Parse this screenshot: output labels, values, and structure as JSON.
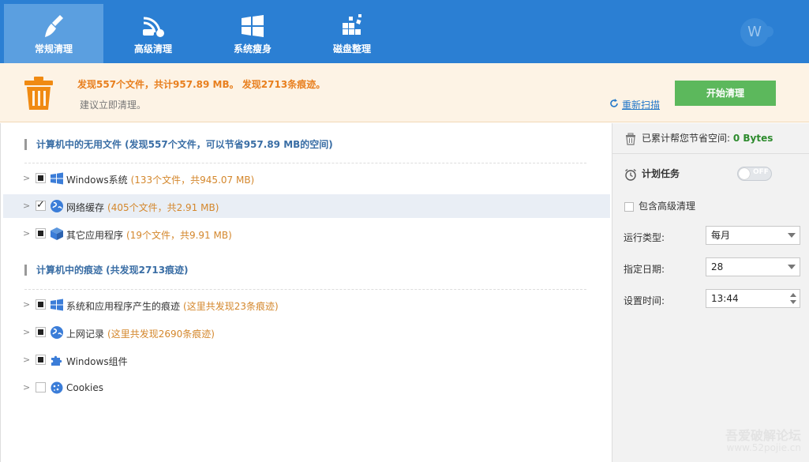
{
  "tabs": [
    {
      "label": "常规清理",
      "icon": "broom-icon"
    },
    {
      "label": "高级清理",
      "icon": "vacuum-icon"
    },
    {
      "label": "系统瘦身",
      "icon": "windows-icon"
    },
    {
      "label": "磁盘整理",
      "icon": "defrag-icon"
    }
  ],
  "avatar_letter": "W",
  "notice": {
    "headline": "发现557个文件，共计957.89 MB。 发现2713条痕迹。",
    "sub": "建议立即清理。",
    "rescan": "重新扫描",
    "start": "开始清理"
  },
  "sections": [
    {
      "title": "计算机中的无用文件 (发现557个文件，可以节省957.89 MB的空间)"
    },
    {
      "title": "计算机中的痕迹 (共发现2713痕迹)"
    }
  ],
  "rows": [
    {
      "name": "Windows系统",
      "info": "(133个文件，共945.07 MB)",
      "check": "partial",
      "icon": "windows-icon"
    },
    {
      "name": "网络缓存",
      "info": "(405个文件，共2.91 MB)",
      "check": "checked",
      "icon": "globe-icon"
    },
    {
      "name": "其它应用程序",
      "info": "(19个文件，共9.91 MB)",
      "check": "partial",
      "icon": "box-icon"
    },
    {
      "name": "系统和应用程序产生的痕迹",
      "info": "(这里共发现23条痕迹)",
      "check": "partial",
      "icon": "windows-icon"
    },
    {
      "name": "上网记录",
      "info": "(这里共发现2690条痕迹)",
      "check": "partial",
      "icon": "globe-icon"
    },
    {
      "name": "Windows组件",
      "info": "",
      "check": "partial",
      "icon": "puzzle-icon"
    },
    {
      "name": "Cookies",
      "info": "",
      "check": "none",
      "icon": "cookie-icon"
    }
  ],
  "right": {
    "saved_label": "已累计帮您节省空间:",
    "saved_value": "0 Bytes",
    "schedule_label": "计划任务",
    "toggle_text": "OFF",
    "advanced_label": "包含高级清理",
    "run_type_label": "运行类型:",
    "run_type_value": "每月",
    "date_label": "指定日期:",
    "date_value": "28",
    "time_label": "设置时间:",
    "time_value": "13:44"
  },
  "watermark": {
    "line1": "吾爱破解论坛",
    "line2": "www.52pojie.cn"
  },
  "colors": {
    "topbar": "#2b7fd3",
    "accent_orange": "#e87f1e",
    "start_green": "#5cb85c"
  }
}
